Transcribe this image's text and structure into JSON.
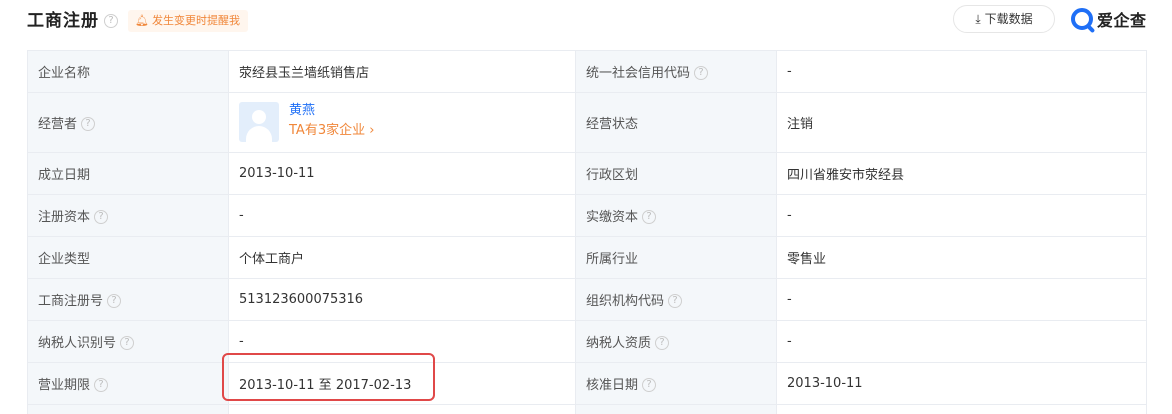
{
  "header": {
    "title": "工商注册",
    "remind_label": "发生变更时提醒我",
    "download_label": "下载数据",
    "brand": "爱企查"
  },
  "rows": [
    {
      "l1": "企业名称",
      "v1": "荥经县玉兰墙纸销售店",
      "l2": "统一社会信用代码",
      "v2": "-"
    },
    {
      "l1": "经营者",
      "l2": "经营状态",
      "v2": "注销"
    },
    {
      "l1": "成立日期",
      "v1": "2013-10-11",
      "l2": "行政区划",
      "v2": "四川省雅安市荥经县"
    },
    {
      "l1": "注册资本",
      "v1": "-",
      "l2": "实缴资本",
      "v2": "-"
    },
    {
      "l1": "企业类型",
      "v1": "个体工商户",
      "l2": "所属行业",
      "v2": "零售业"
    },
    {
      "l1": "工商注册号",
      "v1": "513123600075316",
      "l2": "组织机构代码",
      "v2": "-"
    },
    {
      "l1": "纳税人识别号",
      "v1": "-",
      "l2": "纳税人资质",
      "v2": "-"
    },
    {
      "l1": "营业期限",
      "v1": "2013-10-11 至 2017-02-13",
      "l2": "核准日期",
      "v2": "2013-10-11"
    }
  ],
  "operator": {
    "name": "黄燕",
    "companies_link": "TA有3家企业 ›"
  }
}
